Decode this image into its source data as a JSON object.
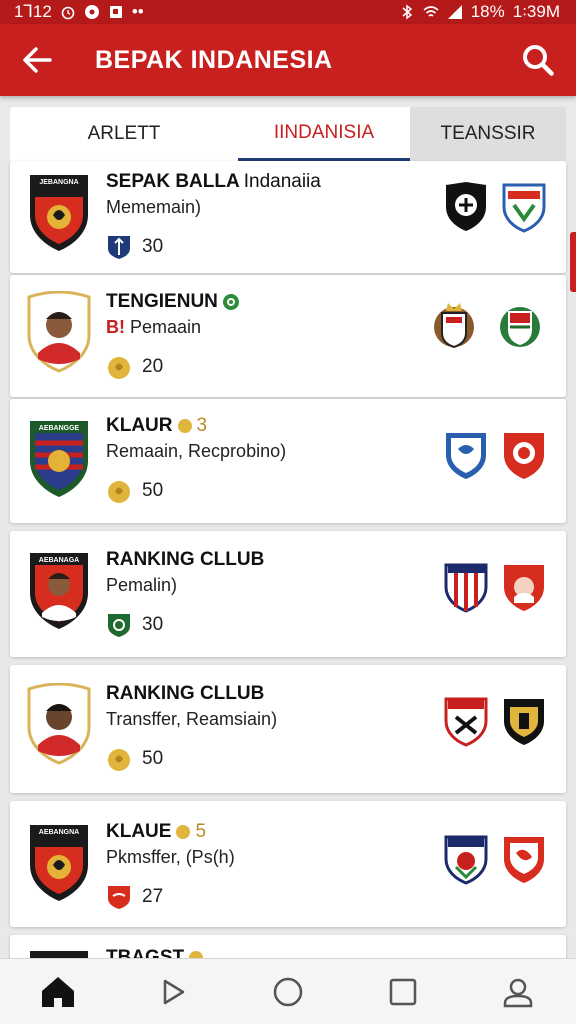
{
  "status": {
    "time": "1Ꞁ12",
    "battery": "18%",
    "clock": "1꞉39M"
  },
  "appbar": {
    "title": "BEPAK INDANESIA"
  },
  "tabs": [
    {
      "label": "ARLETT"
    },
    {
      "label": "IINDANISIA",
      "active": true
    },
    {
      "label": "TEANSSIR"
    }
  ],
  "cards": [
    {
      "name": "SEPAK BALLA",
      "name_suffix": "Indanaiia",
      "badge": "",
      "sub": "Mememain)",
      "count": "30"
    },
    {
      "name": "TENGIENUN",
      "name_suffix": "",
      "badge": "",
      "sub_prefix": "B!",
      "sub": "Pemaain",
      "count": "20"
    },
    {
      "name": "KLAUR",
      "name_suffix": "",
      "badge": "3",
      "sub": "Remaain, Recprobino)",
      "count": "50"
    },
    {
      "name": "RANKING CLLUB",
      "name_suffix": "",
      "badge": "",
      "sub": "Pemalin)",
      "count": "30"
    },
    {
      "name": "RANKING CLLUB",
      "name_suffix": "",
      "badge": "",
      "sub": "Transffer, Reamsiain)",
      "count": "50"
    },
    {
      "name": "KLAUE",
      "name_suffix": "",
      "badge": "5",
      "sub": "Pkmsffer, (Ps(h)",
      "count": "27"
    },
    {
      "name": "TBAGST",
      "name_suffix": "",
      "badge": "",
      "sub": "",
      "count": ""
    }
  ],
  "colors": {
    "primary": "#c8201e",
    "tab_indicator": "#1e3d73",
    "gold": "#d4a72c"
  }
}
